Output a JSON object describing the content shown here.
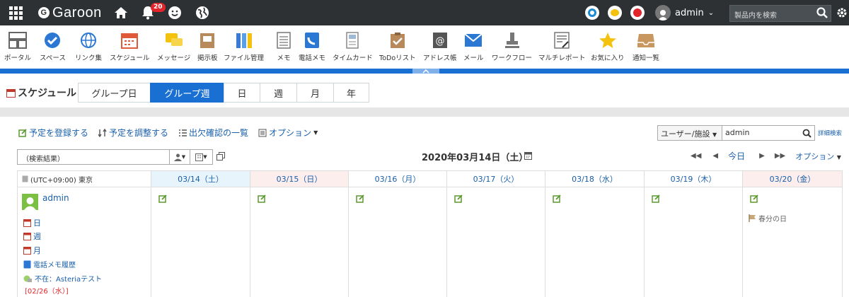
{
  "topbar": {
    "brand": "Garoon",
    "notification_count": "20",
    "user_name": "admin",
    "search_placeholder": "製品内を検索"
  },
  "apps": [
    {
      "label": "ポータル",
      "icon": "portal-icon"
    },
    {
      "label": "スペース",
      "icon": "space-icon"
    },
    {
      "label": "リンク集",
      "icon": "link-icon"
    },
    {
      "label": "スケジュール",
      "icon": "schedule-icon"
    },
    {
      "label": "メッセージ",
      "icon": "message-icon"
    },
    {
      "label": "掲示板",
      "icon": "bulletin-icon"
    },
    {
      "label": "ファイル管理",
      "icon": "file-icon"
    },
    {
      "label": "メモ",
      "icon": "memo-icon"
    },
    {
      "label": "電話メモ",
      "icon": "phone-memo-icon"
    },
    {
      "label": "タイムカード",
      "icon": "timecard-icon"
    },
    {
      "label": "ToDoリスト",
      "icon": "todo-icon"
    },
    {
      "label": "アドレス帳",
      "icon": "address-icon"
    },
    {
      "label": "メール",
      "icon": "mail-icon"
    },
    {
      "label": "ワークフロー",
      "icon": "workflow-icon"
    },
    {
      "label": "マルチレポート",
      "icon": "report-icon"
    },
    {
      "label": "お気に入り",
      "icon": "star-icon"
    },
    {
      "label": "通知一覧",
      "icon": "notification-list-icon"
    }
  ],
  "schedule": {
    "title": "スケジュール",
    "tabs": [
      "グループ日",
      "グループ週",
      "日",
      "週",
      "月",
      "年"
    ],
    "active_tab": "グループ週"
  },
  "toolbar": {
    "register": "予定を登録する",
    "adjust": "予定を調整する",
    "attendance": "出欠確認の一覧",
    "options": "オプション"
  },
  "search": {
    "type": "ユーザー/施設",
    "value": "admin",
    "detail": "詳細検索",
    "result_select": "（検索結果）"
  },
  "date_title": "2020年03月14日（土）",
  "nav": {
    "today": "今日",
    "options": "オプション"
  },
  "calendar": {
    "timezone": "(UTC+09:00) 東京",
    "days": [
      {
        "label": "03/14（土）",
        "type": "sat"
      },
      {
        "label": "03/15（日）",
        "type": "sun"
      },
      {
        "label": "03/16（月）",
        "type": "weekday"
      },
      {
        "label": "03/17（火）",
        "type": "weekday"
      },
      {
        "label": "03/18（水）",
        "type": "weekday"
      },
      {
        "label": "03/19（木）",
        "type": "weekday"
      },
      {
        "label": "03/20（金）",
        "type": "holiday"
      }
    ],
    "holiday_label": "春分の日",
    "user": {
      "name": "admin",
      "links": [
        "日",
        "週",
        "月",
        "電話メモ履歴"
      ],
      "absence": "不在：Asteriaテスト",
      "absence_date": "[02/26（水）]"
    }
  },
  "colors": {
    "topbar": "#2d3134",
    "accent": "#1a6fd3",
    "link": "#1a5faa",
    "sat_header": "#e8f4fc",
    "sun_header": "#fdeeee"
  }
}
